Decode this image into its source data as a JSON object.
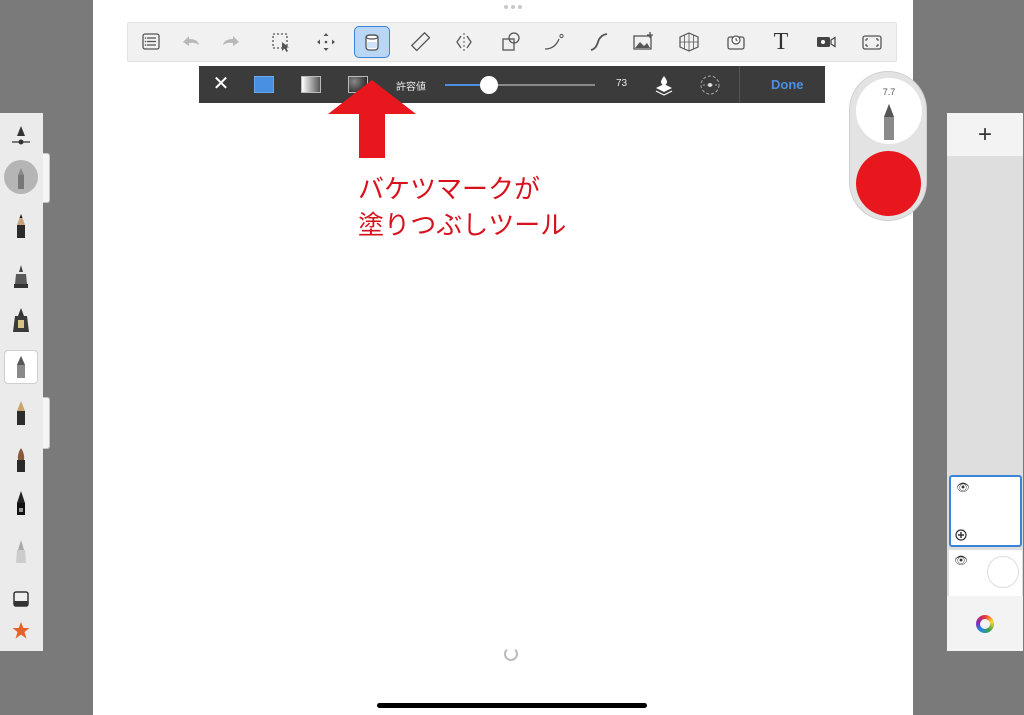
{
  "toolbar": {
    "tools": [
      {
        "name": "menu-list-icon"
      },
      {
        "name": "undo-icon"
      },
      {
        "name": "redo-icon"
      },
      {
        "name": "selection-tool-icon"
      },
      {
        "name": "transform-move-icon"
      },
      {
        "name": "fill-bucket-icon",
        "active": true
      },
      {
        "name": "ruler-icon"
      },
      {
        "name": "symmetry-icon"
      },
      {
        "name": "shape-icon"
      },
      {
        "name": "curve-icon"
      },
      {
        "name": "stroke-icon"
      },
      {
        "name": "image-import-icon"
      },
      {
        "name": "perspective-grid-icon"
      },
      {
        "name": "flipbook-icon"
      },
      {
        "name": "text-tool-icon",
        "glyph": "T"
      },
      {
        "name": "record-icon"
      },
      {
        "name": "fullscreen-icon"
      }
    ]
  },
  "fill_bar": {
    "close_glyph": "✕",
    "tolerance_label": "許容値",
    "tolerance_value": "73",
    "tolerance_fraction": 0.29,
    "done_label": "Done",
    "accent_color": "#4a90e2"
  },
  "annotation": {
    "line1": "バケツマークが",
    "line2": "塗りつぶしツール",
    "color": "#d7121c"
  },
  "puck": {
    "brush_size": "7.7",
    "color": "#e8171e"
  },
  "layers": {
    "add_glyph": "+",
    "eye_glyph": "👁"
  }
}
